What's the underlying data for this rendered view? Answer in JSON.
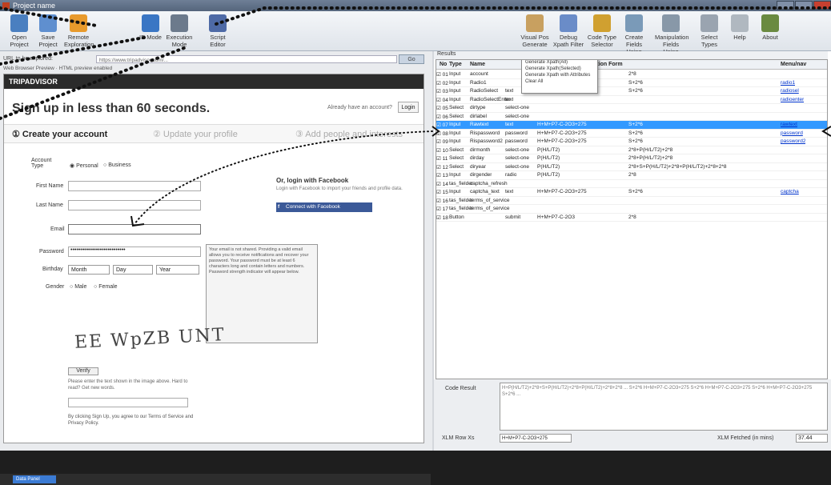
{
  "window": {
    "title": "Project name"
  },
  "ribbon": {
    "left": [
      {
        "label": "Open Project",
        "icon": "open-project-icon",
        "color": "#4a7fc0"
      },
      {
        "label": "Save Project",
        "icon": "save-project-icon",
        "color": "#5f8fcf"
      },
      {
        "label": "Remote Exploration",
        "icon": "remote-icon",
        "color": "#e89a2c"
      },
      {
        "label": "IE Mode",
        "icon": "ie-mode-icon",
        "color": "#3a76c4"
      },
      {
        "label": "Execution Mode",
        "icon": "execution-mode-icon",
        "color": "#6c7a8c"
      },
      {
        "label": "Script Editor",
        "icon": "script-editor-icon",
        "color": "#4e6aa6"
      }
    ],
    "right": [
      {
        "label": "Visual Pos Generate",
        "icon": "visual-pos-icon",
        "color": "#c8a060"
      },
      {
        "label": "Debug Xpath Filter",
        "icon": "debug-xpath-icon",
        "color": "#6a8cc8"
      },
      {
        "label": "Code Type Selector",
        "icon": "code-type-icon",
        "color": "#d0a030"
      },
      {
        "label": "Create Fields Using Xpath",
        "icon": "create-fields-icon",
        "color": "#7a9ab8"
      },
      {
        "label": "Manipulation Fields Using Xpath",
        "icon": "manipulation-fields-icon",
        "color": "#8898a8"
      },
      {
        "label": "Select Types",
        "icon": "select-types-icon",
        "color": "#9aa4b0"
      },
      {
        "label": "Help",
        "icon": "help-icon",
        "color": "#b0b8c0"
      },
      {
        "label": "About",
        "icon": "about-icon",
        "color": "#6a8a40"
      }
    ]
  },
  "browser": {
    "address_label": "URL to be explored:",
    "address": "https://www.tripadvisor.com/...",
    "go": "Go",
    "compat": "Web Browser Preview  ·  HTML preview enabled",
    "brand": "TRIPADVISOR",
    "headline": "Sign up in less than 60 seconds.",
    "already": "Already have an account?",
    "login": "Login",
    "steps": [
      "① Create your account",
      "② Update your profile",
      "③ Add people and interests"
    ],
    "form": {
      "account_type_label": "Account Type",
      "account_type_options": [
        "Personal",
        "Business"
      ],
      "first_name": "First Name",
      "last_name": "Last Name",
      "email": "Email",
      "password": "Password",
      "password_value": "••••••••••••••••••••••••••••",
      "birthday": "Birthday",
      "birthday_selects": [
        "Month",
        "Day",
        "Year"
      ],
      "gender": "Gender",
      "gender_options": [
        "Male",
        "Female"
      ]
    },
    "facebook": {
      "heading": "Or, login with Facebook",
      "text": "Login with Facebook to import your friends and profile data.",
      "button": "Connect with Facebook"
    },
    "tip": "Your email is not shared. Providing a valid email allows you to receive notifications and recover your password. Your password must be at least 6 characters long and contain letters and numbers. Password strength indicator will appear below.",
    "captcha": "EE WpZB UNT",
    "captcha_button": "Verify",
    "captcha_hint": "Please enter the text shown in the image above. Hard to read? Get new words.",
    "terms": "By clicking Sign Up, you agree to our Terms of Service and Privacy Policy."
  },
  "taskbar": {
    "start": "Data Panel"
  },
  "grid": {
    "title": "Results",
    "headers": [
      "No",
      "Type",
      "Name",
      "",
      "",
      "Manipulation Form",
      "",
      "Menu/nav"
    ],
    "rows": [
      {
        "n": "01",
        "t": "Input",
        "name": "account",
        "x": "",
        "f": "",
        "m": "2*8",
        "link": ""
      },
      {
        "n": "02",
        "t": "Input",
        "name": "Radio1",
        "x": "",
        "f": "H+M+P7-C",
        "m": "S+2*6",
        "link": "radio1"
      },
      {
        "n": "03",
        "t": "Input",
        "name": "RadioSelect",
        "x": "text",
        "f": "H+M+P7-C-2O3+275",
        "m": "S+2*6",
        "link": "radiosel"
      },
      {
        "n": "04",
        "t": "Input",
        "name": "RadioSelectEnter",
        "x": "text",
        "f": "",
        "m": "",
        "link": "radioenter"
      },
      {
        "n": "05",
        "t": "Select",
        "name": "dirtype",
        "x": "select-one",
        "f": "",
        "m": "",
        "link": ""
      },
      {
        "n": "06",
        "t": "Select",
        "name": "dirlabel",
        "x": "select-one",
        "f": "",
        "m": "",
        "link": ""
      },
      {
        "n": "07",
        "t": "Input",
        "name": "Rawtext",
        "x": "text",
        "f": "H+M+P7-C-2O3+275",
        "m": "S+2*6",
        "link": "rawtext",
        "sel": true
      },
      {
        "n": "08",
        "t": "Input",
        "name": "Rispassword",
        "x": "password",
        "f": "H+M+P7-C-2O3+275",
        "m": "S+2*6",
        "link": "password"
      },
      {
        "n": "09",
        "t": "Input",
        "name": "Rispassword2",
        "x": "password",
        "f": "H+M+P7-C-2O3+275",
        "m": "S+2*6",
        "link": "password2"
      },
      {
        "n": "10",
        "t": "Select",
        "name": "dirmonth",
        "x": "select-one",
        "f": "P(H/L/T2)",
        "m": "2*8+P(H/L/T2)+2*8",
        "link": ""
      },
      {
        "n": "11",
        "t": "Select",
        "name": "dirday",
        "x": "select-one",
        "f": "P(H/L/T2)",
        "m": "2*8+P(H/L/T2)+2*8",
        "link": ""
      },
      {
        "n": "12",
        "t": "Select",
        "name": "diryear",
        "x": "select-one",
        "f": "P(H/L/T2)",
        "m": "2*8+S+P(H/L/T2)+2*8+P(H/L/T2)+2*8+2*8",
        "link": ""
      },
      {
        "n": "13",
        "t": "Input",
        "name": "dirgender",
        "x": "radio",
        "f": "P(H/L/T2)",
        "m": "2*8",
        "link": ""
      },
      {
        "n": "14",
        "t": "tas_fielder",
        "name": "captcha_refresh",
        "x": "",
        "f": "",
        "m": "",
        "link": ""
      },
      {
        "n": "15",
        "t": "Input",
        "name": "captcha_text",
        "x": "text",
        "f": "H+M+P7-C-2O3+275",
        "m": "S+2*6",
        "link": "captcha"
      },
      {
        "n": "16",
        "t": "tas_fielder",
        "name": "terms_of_service",
        "x": "",
        "f": "",
        "m": "",
        "link": ""
      },
      {
        "n": "17",
        "t": "tas_fielder",
        "name": "terms_of_service",
        "x": "",
        "f": "",
        "m": "",
        "link": ""
      },
      {
        "n": "18",
        "t": "Button",
        "name": "",
        "x": "submit",
        "f": "H+M+P7-C-2O3",
        "m": "2*8",
        "link": ""
      }
    ],
    "context_menu": [
      "Generate Xpath(All)",
      "Generate Xpath(Selected)",
      "Generate Xpath with Attributes",
      "Clear All"
    ]
  },
  "bottom": {
    "code_label": "Code Result",
    "code_text": "H+P(H/L/T2)+2*8+S+P(H/L/T2)+2*8+P(H/L/T2)+2*8+2*8 ... S+2*6 H+M+P7-C-2O3+275 S+2*6 H+M+P7-C-2O3+275 S+2*6 H+M+P7-C-2O3+275 S+2*6 ...",
    "xpath_label": "XLM Row Xs",
    "xpath_value": "H+M+P7-C-2O3+275",
    "time_label": "XLM Fetched (in mins)",
    "time_value": "37.44"
  }
}
